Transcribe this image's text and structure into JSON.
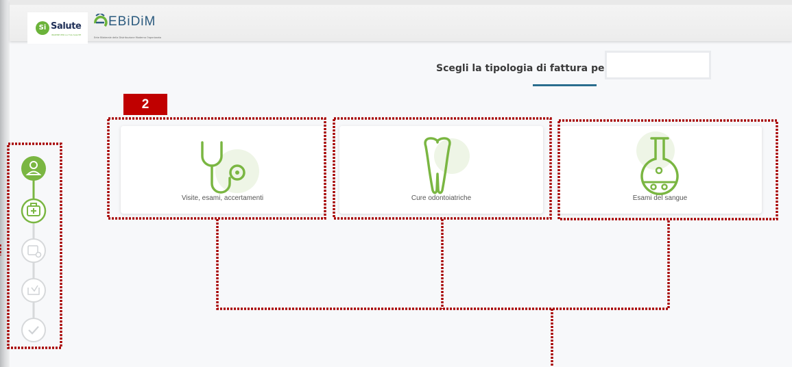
{
  "header": {
    "logo_primary": {
      "text": "Salute",
      "badge": "Si",
      "tagline": "INSIEME PER LA TUA SALUTE"
    },
    "logo_secondary": {
      "text": "EBiDiM",
      "tagline": "Ente Bilaterale della Distribuzione Moderna Organizzata"
    }
  },
  "page": {
    "title": "Scegli la tipologia di fattura per",
    "name_field_value": ""
  },
  "annotation": {
    "step_badge": "2"
  },
  "cards": [
    {
      "label": "Visite, esami, accertamenti",
      "icon": "stethoscope-icon"
    },
    {
      "label": "Cure odontoiatriche",
      "icon": "tooth-icon"
    },
    {
      "label": "Esami del sangue",
      "icon": "flask-icon"
    }
  ],
  "stepper": {
    "steps": [
      {
        "icon": "user-icon",
        "state": "complete"
      },
      {
        "icon": "medical-kit-icon",
        "state": "active"
      },
      {
        "icon": "calendar-clock-icon",
        "state": "pending"
      },
      {
        "icon": "inbox-download-icon",
        "state": "pending"
      },
      {
        "icon": "checkmark-icon",
        "state": "pending"
      }
    ]
  },
  "colors": {
    "accent_green": "#7ab642",
    "annotation_red": "#c00000",
    "title_underline": "#2a6d8e",
    "logo_navy": "#1f2f57"
  }
}
